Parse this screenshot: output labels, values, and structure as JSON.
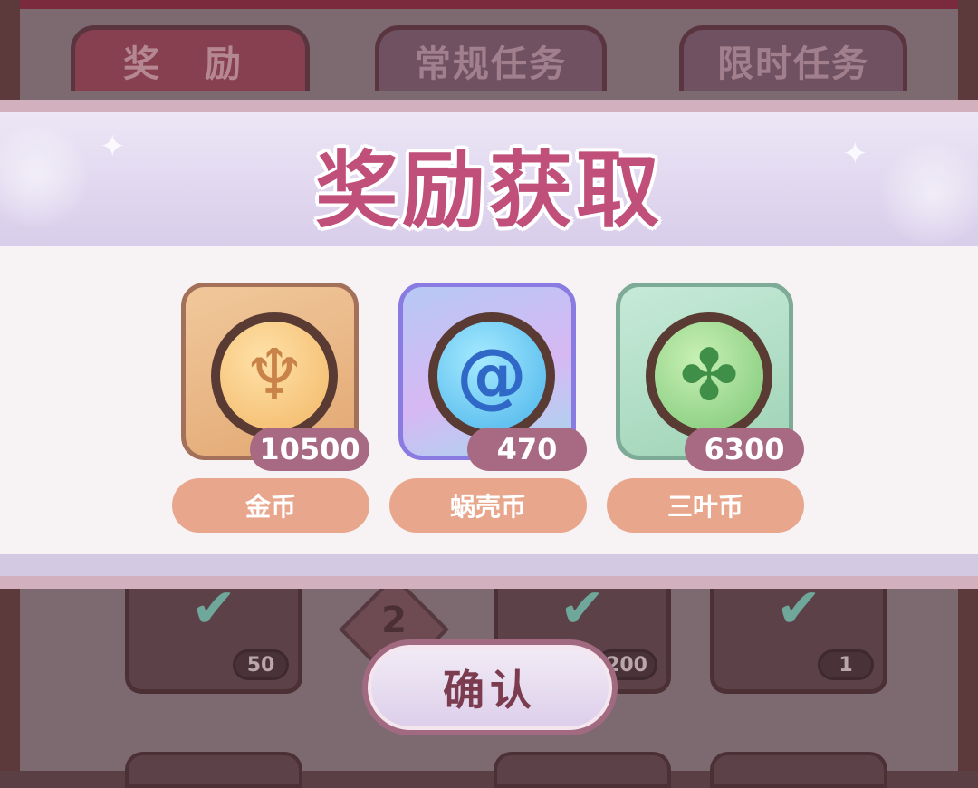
{
  "background": {
    "tabs": [
      {
        "label": "奖 励"
      },
      {
        "label": "常规任务"
      },
      {
        "label": "限时任务"
      }
    ],
    "cards": [
      {
        "qty": "50"
      },
      {
        "qty": "200"
      },
      {
        "qty": "1"
      }
    ],
    "level_badge": "2"
  },
  "modal": {
    "title": "奖励获取",
    "rewards": [
      {
        "name": "金币",
        "amount": "10500",
        "icon": "gold-coin-icon"
      },
      {
        "name": "蜗壳币",
        "amount": "470",
        "icon": "snail-shell-coin-icon"
      },
      {
        "name": "三叶币",
        "amount": "6300",
        "icon": "clover-coin-icon"
      }
    ],
    "confirm_label": "确认"
  },
  "colors": {
    "title": "#c05079",
    "name_pill": "#e8a78d",
    "amount_pill": "#a86a82",
    "confirm_border": "#a16a80"
  }
}
